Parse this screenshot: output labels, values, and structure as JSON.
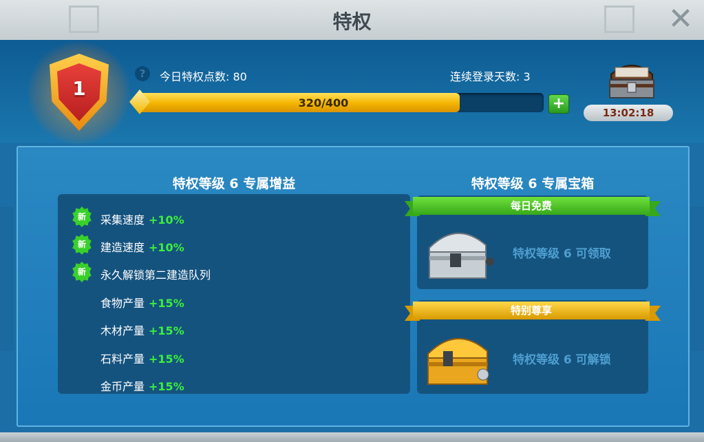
{
  "window": {
    "title": "特权"
  },
  "header": {
    "level": "1",
    "help_icon": "?",
    "today_points": "今日特权点数: 80",
    "login_days": "连续登录天数: 3",
    "progress_text": "320/400",
    "progress_fraction": 0.8,
    "plus_label": "+",
    "timer": "13:02:18"
  },
  "benefits": {
    "heading": "特权等级 6 专属增益",
    "new_badge": "新",
    "items": [
      {
        "label": "采集速度",
        "value": "+10%",
        "is_new": true
      },
      {
        "label": "建造速度",
        "value": "+10%",
        "is_new": true
      },
      {
        "label": "永久解锁第二建造队列",
        "value": "",
        "is_new": true
      },
      {
        "label": "食物产量",
        "value": "+15%",
        "is_new": false
      },
      {
        "label": "木材产量",
        "value": "+15%",
        "is_new": false
      },
      {
        "label": "石料产量",
        "value": "+15%",
        "is_new": false
      },
      {
        "label": "金币产量",
        "value": "+15%",
        "is_new": false
      }
    ]
  },
  "chests": {
    "heading": "特权等级 6 专属宝箱",
    "free": {
      "ribbon": "每日免费",
      "text": "特权等级 6 可领取"
    },
    "special": {
      "ribbon": "特别尊享",
      "text": "特权等级 6 可解锁"
    }
  },
  "colors": {
    "accent_green": "#3bf03b",
    "bar_gold": "#f3b400",
    "panel_blue": "#1a77b6"
  }
}
